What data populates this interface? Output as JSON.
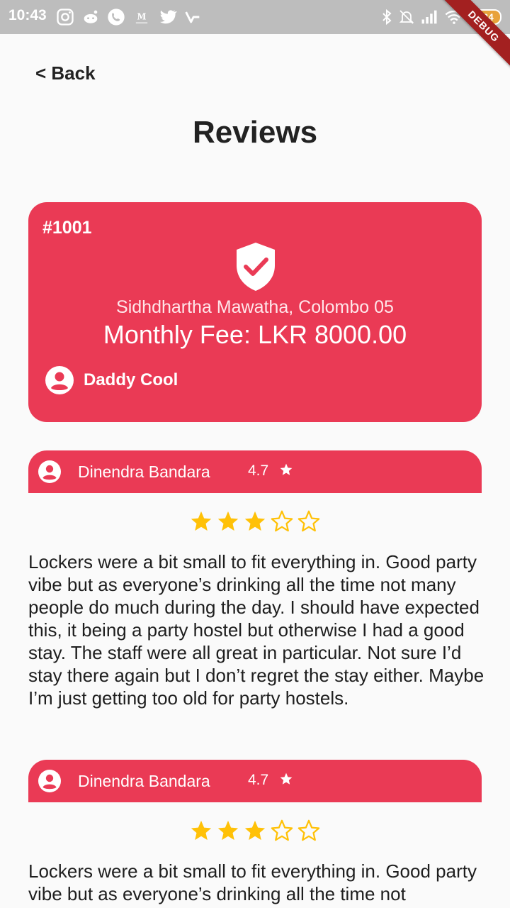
{
  "status_bar": {
    "time": "10:43",
    "battery": "84"
  },
  "debug_banner": "DEBUG",
  "nav": {
    "back_label": "< Back"
  },
  "page": {
    "title": "Reviews"
  },
  "listing": {
    "id": "#1001",
    "address": "Sidhdhartha Mawatha, Colombo 05",
    "fee": "Monthly Fee: LKR 8000.00",
    "owner": "Daddy Cool"
  },
  "reviews": [
    {
      "name": "Dinendra Bandara",
      "rating": "4.7",
      "stars": 3,
      "text": "Lockers were a bit small to fit everything in. Good party vibe but as everyone’s drinking all the time not many people do much during the day. I should have expected this, it being a party hostel but otherwise I had a good stay. The staff were all great in particular. Not sure I’d stay there again but I don’t regret the stay either. Maybe I’m just getting too old for party hostels."
    },
    {
      "name": "Dinendra Bandara",
      "rating": "4.7",
      "stars": 3,
      "text": "Lockers were a bit small to fit everything in. Good party vibe but as everyone’s drinking all the time not"
    }
  ],
  "colors": {
    "accent": "#ea3a55",
    "star": "#ffc107",
    "status_bar": "#bdbdbd"
  }
}
